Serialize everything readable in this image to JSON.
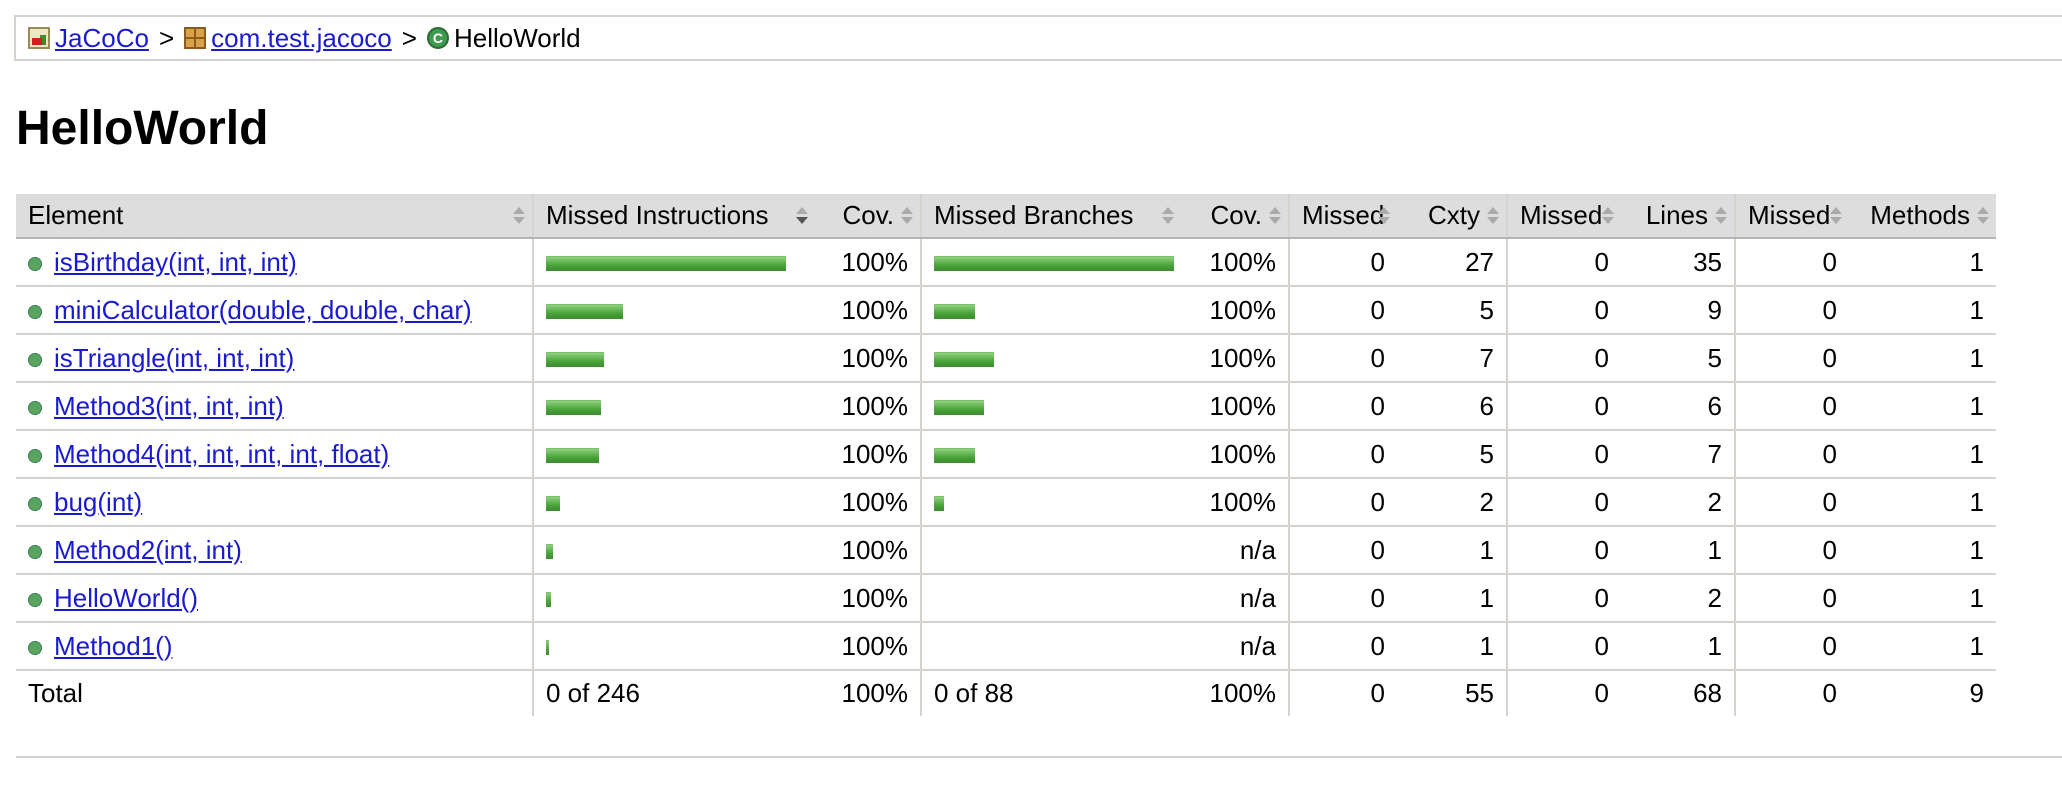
{
  "breadcrumb": {
    "report": "JaCoCo",
    "package": "com.test.jacoco",
    "class": "HelloWorld",
    "separator": ">"
  },
  "icons": {
    "report": "report-icon",
    "package": "package-icon",
    "class": "class-icon",
    "class_letter": "C"
  },
  "page_title": "HelloWorld",
  "table": {
    "headers": {
      "element": "Element",
      "missed_instructions": "Missed Instructions",
      "instr_cov": "Cov.",
      "missed_branches": "Missed Branches",
      "branch_cov": "Cov.",
      "missed_cxty": "Missed",
      "cxty": "Cxty",
      "missed_lines": "Missed",
      "lines": "Lines",
      "missed_methods": "Missed",
      "methods": "Methods"
    },
    "sorted_column": "missed_instructions",
    "rows": [
      {
        "element": "isBirthday(int, int, int)",
        "instr_bar": 1.0,
        "instr_cov": "100%",
        "branch_bar": 1.0,
        "branch_cov": "100%",
        "missed_cxty": "0",
        "cxty": "27",
        "missed_lines": "0",
        "lines": "35",
        "missed_methods": "0",
        "methods": "1"
      },
      {
        "element": "miniCalculator(double, double, char)",
        "instr_bar": 0.32,
        "instr_cov": "100%",
        "branch_bar": 0.17,
        "branch_cov": "100%",
        "missed_cxty": "0",
        "cxty": "5",
        "missed_lines": "0",
        "lines": "9",
        "missed_methods": "0",
        "methods": "1"
      },
      {
        "element": "isTriangle(int, int, int)",
        "instr_bar": 0.24,
        "instr_cov": "100%",
        "branch_bar": 0.25,
        "branch_cov": "100%",
        "missed_cxty": "0",
        "cxty": "7",
        "missed_lines": "0",
        "lines": "5",
        "missed_methods": "0",
        "methods": "1"
      },
      {
        "element": "Method3(int, int, int)",
        "instr_bar": 0.23,
        "instr_cov": "100%",
        "branch_bar": 0.21,
        "branch_cov": "100%",
        "missed_cxty": "0",
        "cxty": "6",
        "missed_lines": "0",
        "lines": "6",
        "missed_methods": "0",
        "methods": "1"
      },
      {
        "element": "Method4(int, int, int, int, float)",
        "instr_bar": 0.22,
        "instr_cov": "100%",
        "branch_bar": 0.17,
        "branch_cov": "100%",
        "missed_cxty": "0",
        "cxty": "5",
        "missed_lines": "0",
        "lines": "7",
        "missed_methods": "0",
        "methods": "1"
      },
      {
        "element": "bug(int)",
        "instr_bar": 0.06,
        "instr_cov": "100%",
        "branch_bar": 0.04,
        "branch_cov": "100%",
        "missed_cxty": "0",
        "cxty": "2",
        "missed_lines": "0",
        "lines": "2",
        "missed_methods": "0",
        "methods": "1"
      },
      {
        "element": "Method2(int, int)",
        "instr_bar": 0.03,
        "instr_cov": "100%",
        "branch_bar": 0,
        "branch_cov": "n/a",
        "missed_cxty": "0",
        "cxty": "1",
        "missed_lines": "0",
        "lines": "1",
        "missed_methods": "0",
        "methods": "1"
      },
      {
        "element": "HelloWorld()",
        "instr_bar": 0.02,
        "instr_cov": "100%",
        "branch_bar": 0,
        "branch_cov": "n/a",
        "missed_cxty": "0",
        "cxty": "1",
        "missed_lines": "0",
        "lines": "2",
        "missed_methods": "0",
        "methods": "1"
      },
      {
        "element": "Method1()",
        "instr_bar": 0.01,
        "instr_cov": "100%",
        "branch_bar": 0,
        "branch_cov": "n/a",
        "missed_cxty": "0",
        "cxty": "1",
        "missed_lines": "0",
        "lines": "1",
        "missed_methods": "0",
        "methods": "1"
      }
    ],
    "total": {
      "label": "Total",
      "missed_instructions": "0 of 246",
      "instr_cov": "100%",
      "missed_branches": "0 of 88",
      "branch_cov": "100%",
      "missed_cxty": "0",
      "cxty": "55",
      "missed_lines": "0",
      "lines": "68",
      "missed_methods": "0",
      "methods": "9"
    }
  },
  "colors": {
    "link": "#1a1ad0",
    "bar_green": "#4aa23a",
    "header_bg": "#dddddd",
    "border": "#d6d3ce"
  }
}
